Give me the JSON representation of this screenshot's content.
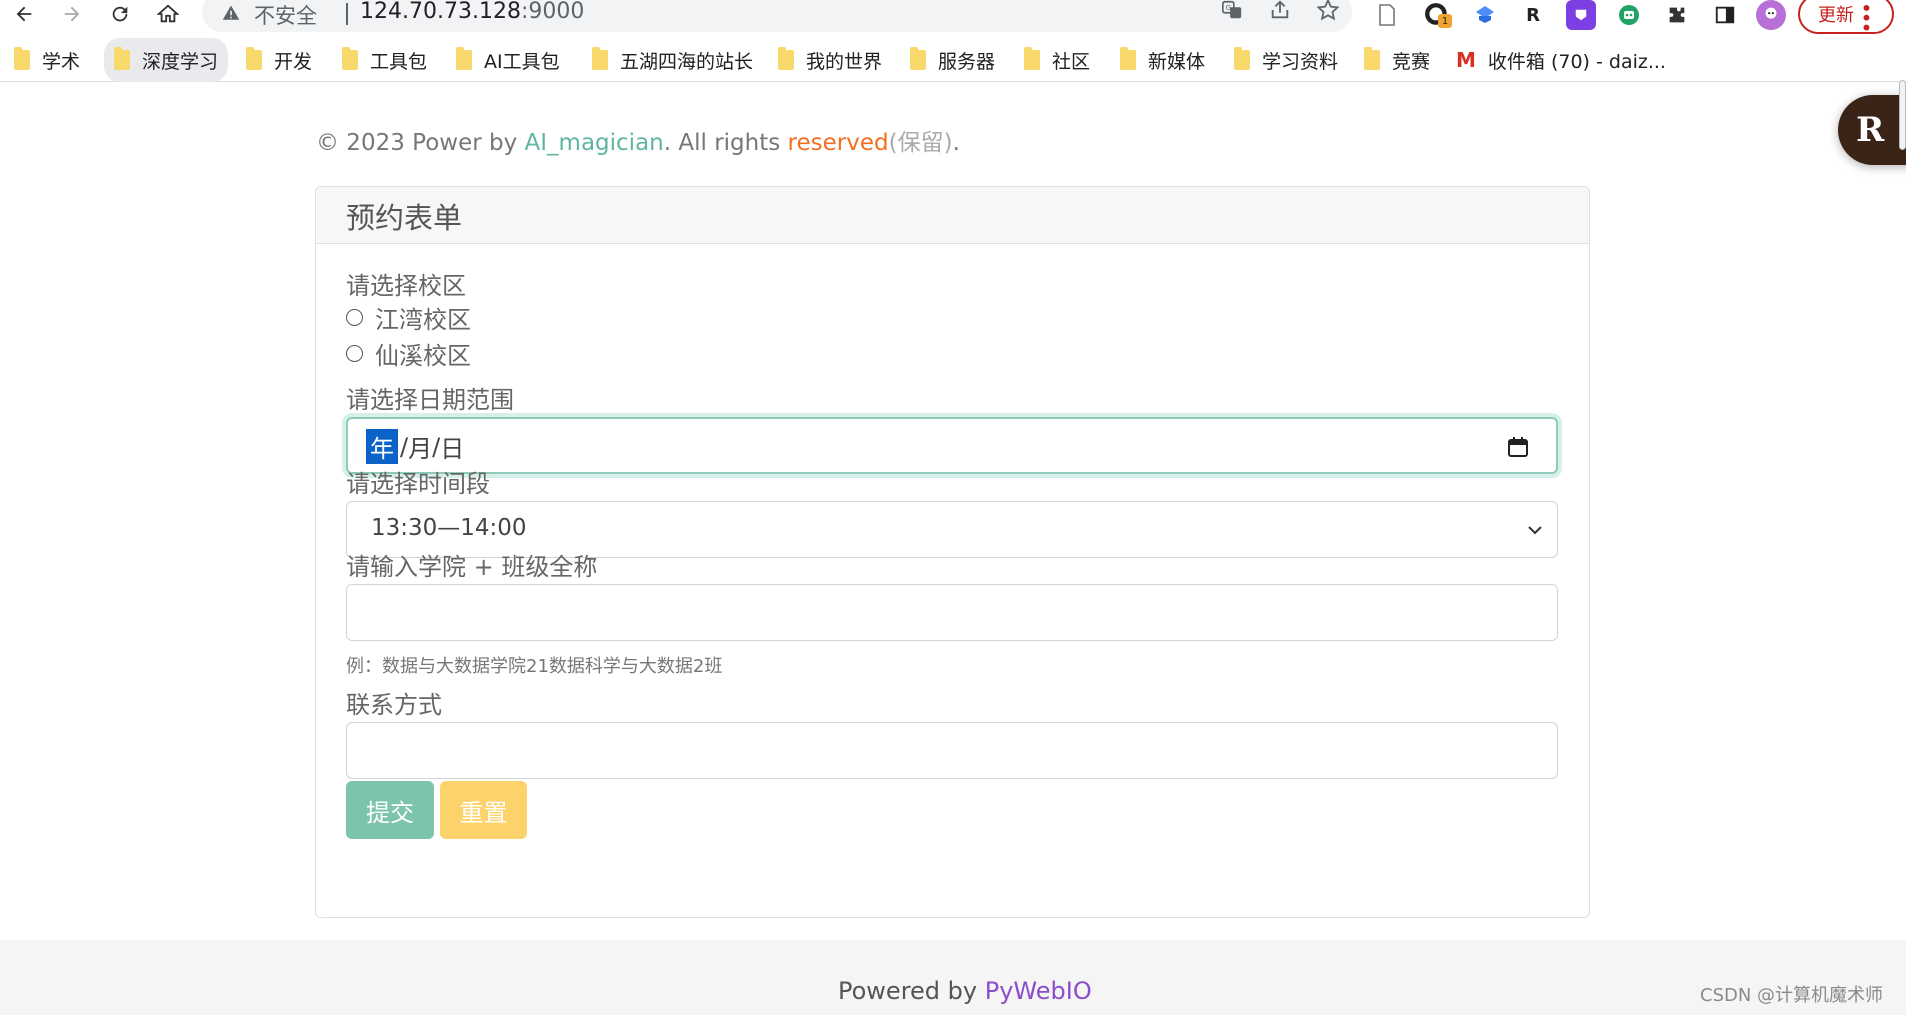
{
  "browser": {
    "insecure_label": "不安全",
    "url_host": "124.70.73.128",
    "url_port": ":9000",
    "update_label": "更新",
    "ext_badge_count": "1",
    "ext_r_letter": "R",
    "bookmarks": [
      {
        "label": "学术",
        "icon": "folder-icon"
      },
      {
        "label": "深度学习",
        "icon": "folder-icon",
        "active": true
      },
      {
        "label": "开发",
        "icon": "folder-icon"
      },
      {
        "label": "工具包",
        "icon": "folder-icon"
      },
      {
        "label": "AI工具包",
        "icon": "folder-icon"
      },
      {
        "label": "五湖四海的站长",
        "icon": "folder-icon"
      },
      {
        "label": "我的世界",
        "icon": "folder-icon"
      },
      {
        "label": "服务器",
        "icon": "folder-icon"
      },
      {
        "label": "社区",
        "icon": "folder-icon"
      },
      {
        "label": "新媒体",
        "icon": "folder-icon"
      },
      {
        "label": "学习资料",
        "icon": "folder-icon"
      },
      {
        "label": "竞赛",
        "icon": "folder-icon"
      },
      {
        "label": "收件箱 (70) - daiz...",
        "icon": "gmail-icon"
      }
    ]
  },
  "copyright": {
    "prefix": "© 2023 Power by ",
    "author": "AI_magician",
    "middle": ". All rights ",
    "reserved": "reserved",
    "paren": "(保留)",
    "suffix": "."
  },
  "form": {
    "title": "预约表单",
    "campus_label": "请选择校区",
    "campus_options": [
      "江湾校区",
      "仙溪校区"
    ],
    "date_label": "请选择日期范围",
    "date_placeholder": {
      "year": "年",
      "month": "月",
      "day": "日",
      "sep": "/"
    },
    "time_label": "请选择时间段",
    "time_value": "13:30—14:00",
    "class_label": "请输入学院 + 班级全称",
    "class_value": "",
    "class_hint": "例：数据与大数据学院21数据科学与大数据2班",
    "contact_label": "联系方式",
    "contact_value": "",
    "submit_label": "提交",
    "reset_label": "重置"
  },
  "footer": {
    "powered_prefix": "Powered by ",
    "powered_link": "PyWebIO",
    "watermark": "CSDN @计算机魔术师"
  },
  "float_button_letter": "R",
  "colors": {
    "accent_green": "#7dc4ad",
    "accent_yellow": "#fcd26a",
    "link_green": "#5fb5a0",
    "link_orange": "#f26e22",
    "link_purple": "#8a4fc8",
    "update_red": "#c5221f"
  }
}
